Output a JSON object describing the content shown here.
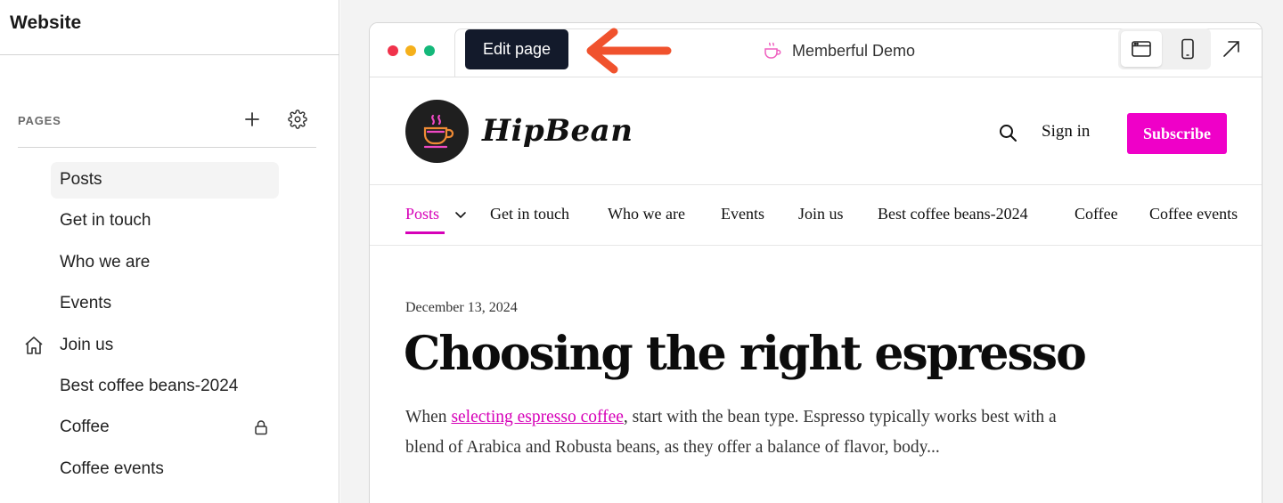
{
  "sidebar": {
    "title": "Website",
    "pages_label": "PAGES",
    "items": [
      {
        "label": "Posts",
        "active": true
      },
      {
        "label": "Get in touch"
      },
      {
        "label": "Who we are"
      },
      {
        "label": "Events"
      },
      {
        "label": "Join us",
        "icon": "home-icon"
      },
      {
        "label": "Best coffee beans-2024"
      },
      {
        "label": "Coffee",
        "icon": "lock-icon"
      },
      {
        "label": "Coffee events"
      }
    ]
  },
  "preview": {
    "edit_label": "Edit page",
    "site_name": "Memberful Demo"
  },
  "site": {
    "logo": "HipBean",
    "signin": "Sign in",
    "subscribe": "Subscribe",
    "nav": [
      "Posts",
      "Get in touch",
      "Who we are",
      "Events",
      "Join us",
      "Best coffee beans-2024",
      "Coffee",
      "Coffee events"
    ]
  },
  "post": {
    "date": "December 13, 2024",
    "title": "Choosing the right espresso",
    "body_before": "When ",
    "link": "selecting espresso coffee",
    "body_after": ", start with the bean type. Espresso typically works best with a blend of Arabica and Robusta beans, as they offer a balance of flavor, body..."
  },
  "colors": {
    "accent": "#ef00c8",
    "arrow": "#f0522d",
    "edit_button": "#131a2b"
  }
}
